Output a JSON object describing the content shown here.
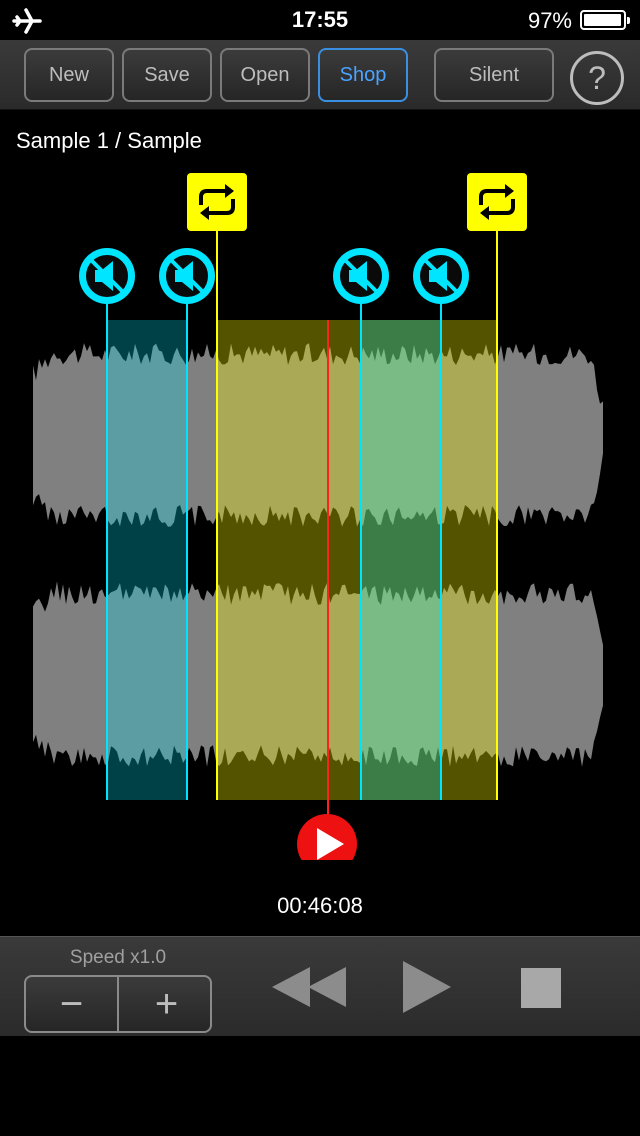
{
  "status_bar": {
    "time": "17:55",
    "battery_percent": "97%",
    "battery_level": 0.97,
    "airplane_icon": "airplane-icon"
  },
  "toolbar": {
    "buttons": [
      "New",
      "Save",
      "Open",
      "Shop",
      "Silent"
    ],
    "active_button": "Shop",
    "help_label": "?"
  },
  "track": {
    "title": "Sample 1 / Sample"
  },
  "markers": {
    "loop_icons": [
      "loop-start-icon",
      "loop-end-icon"
    ],
    "mute_icons": [
      "mute-start-icon-1",
      "mute-end-icon-1",
      "mute-start-icon-2",
      "mute-end-icon-2"
    ],
    "play_marker_icon": "play-marker-icon"
  },
  "playback": {
    "time": "00:46:08"
  },
  "speed": {
    "label": "Speed  x1.0",
    "minus": "−",
    "plus": "+"
  },
  "controls": {
    "icons": [
      "rewind-icon",
      "play-icon",
      "stop-icon"
    ]
  },
  "colors": {
    "loop": "#ffff00",
    "mute": "#00e5ff",
    "playhead": "#ff2020",
    "active_button": "#4aa3ff",
    "waveform": "#808080"
  }
}
